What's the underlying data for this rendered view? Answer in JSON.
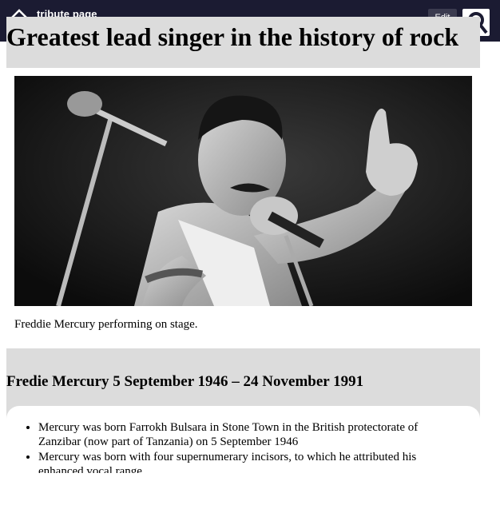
{
  "topbar": {
    "logo_text": "tribute page",
    "button_label": "Edit"
  },
  "heading": "Greatest lead singer in the history of rock",
  "photo_caption": "Freddie Mercury performing on stage.",
  "bio": {
    "title": "Fredie Mercury 5 September 1946 – 24 November 1991",
    "facts": [
      "Mercury was born Farrokh Bulsara in Stone Town in the British protectorate of Zanzibar (now part of Tanzania) on 5 September 1946",
      "Mercury was born with four supernumerary incisors, to which he attributed his enhanced vocal range"
    ]
  },
  "colors": {
    "topbar": "#1b1b32",
    "section_bg": "#dcdcdc"
  }
}
